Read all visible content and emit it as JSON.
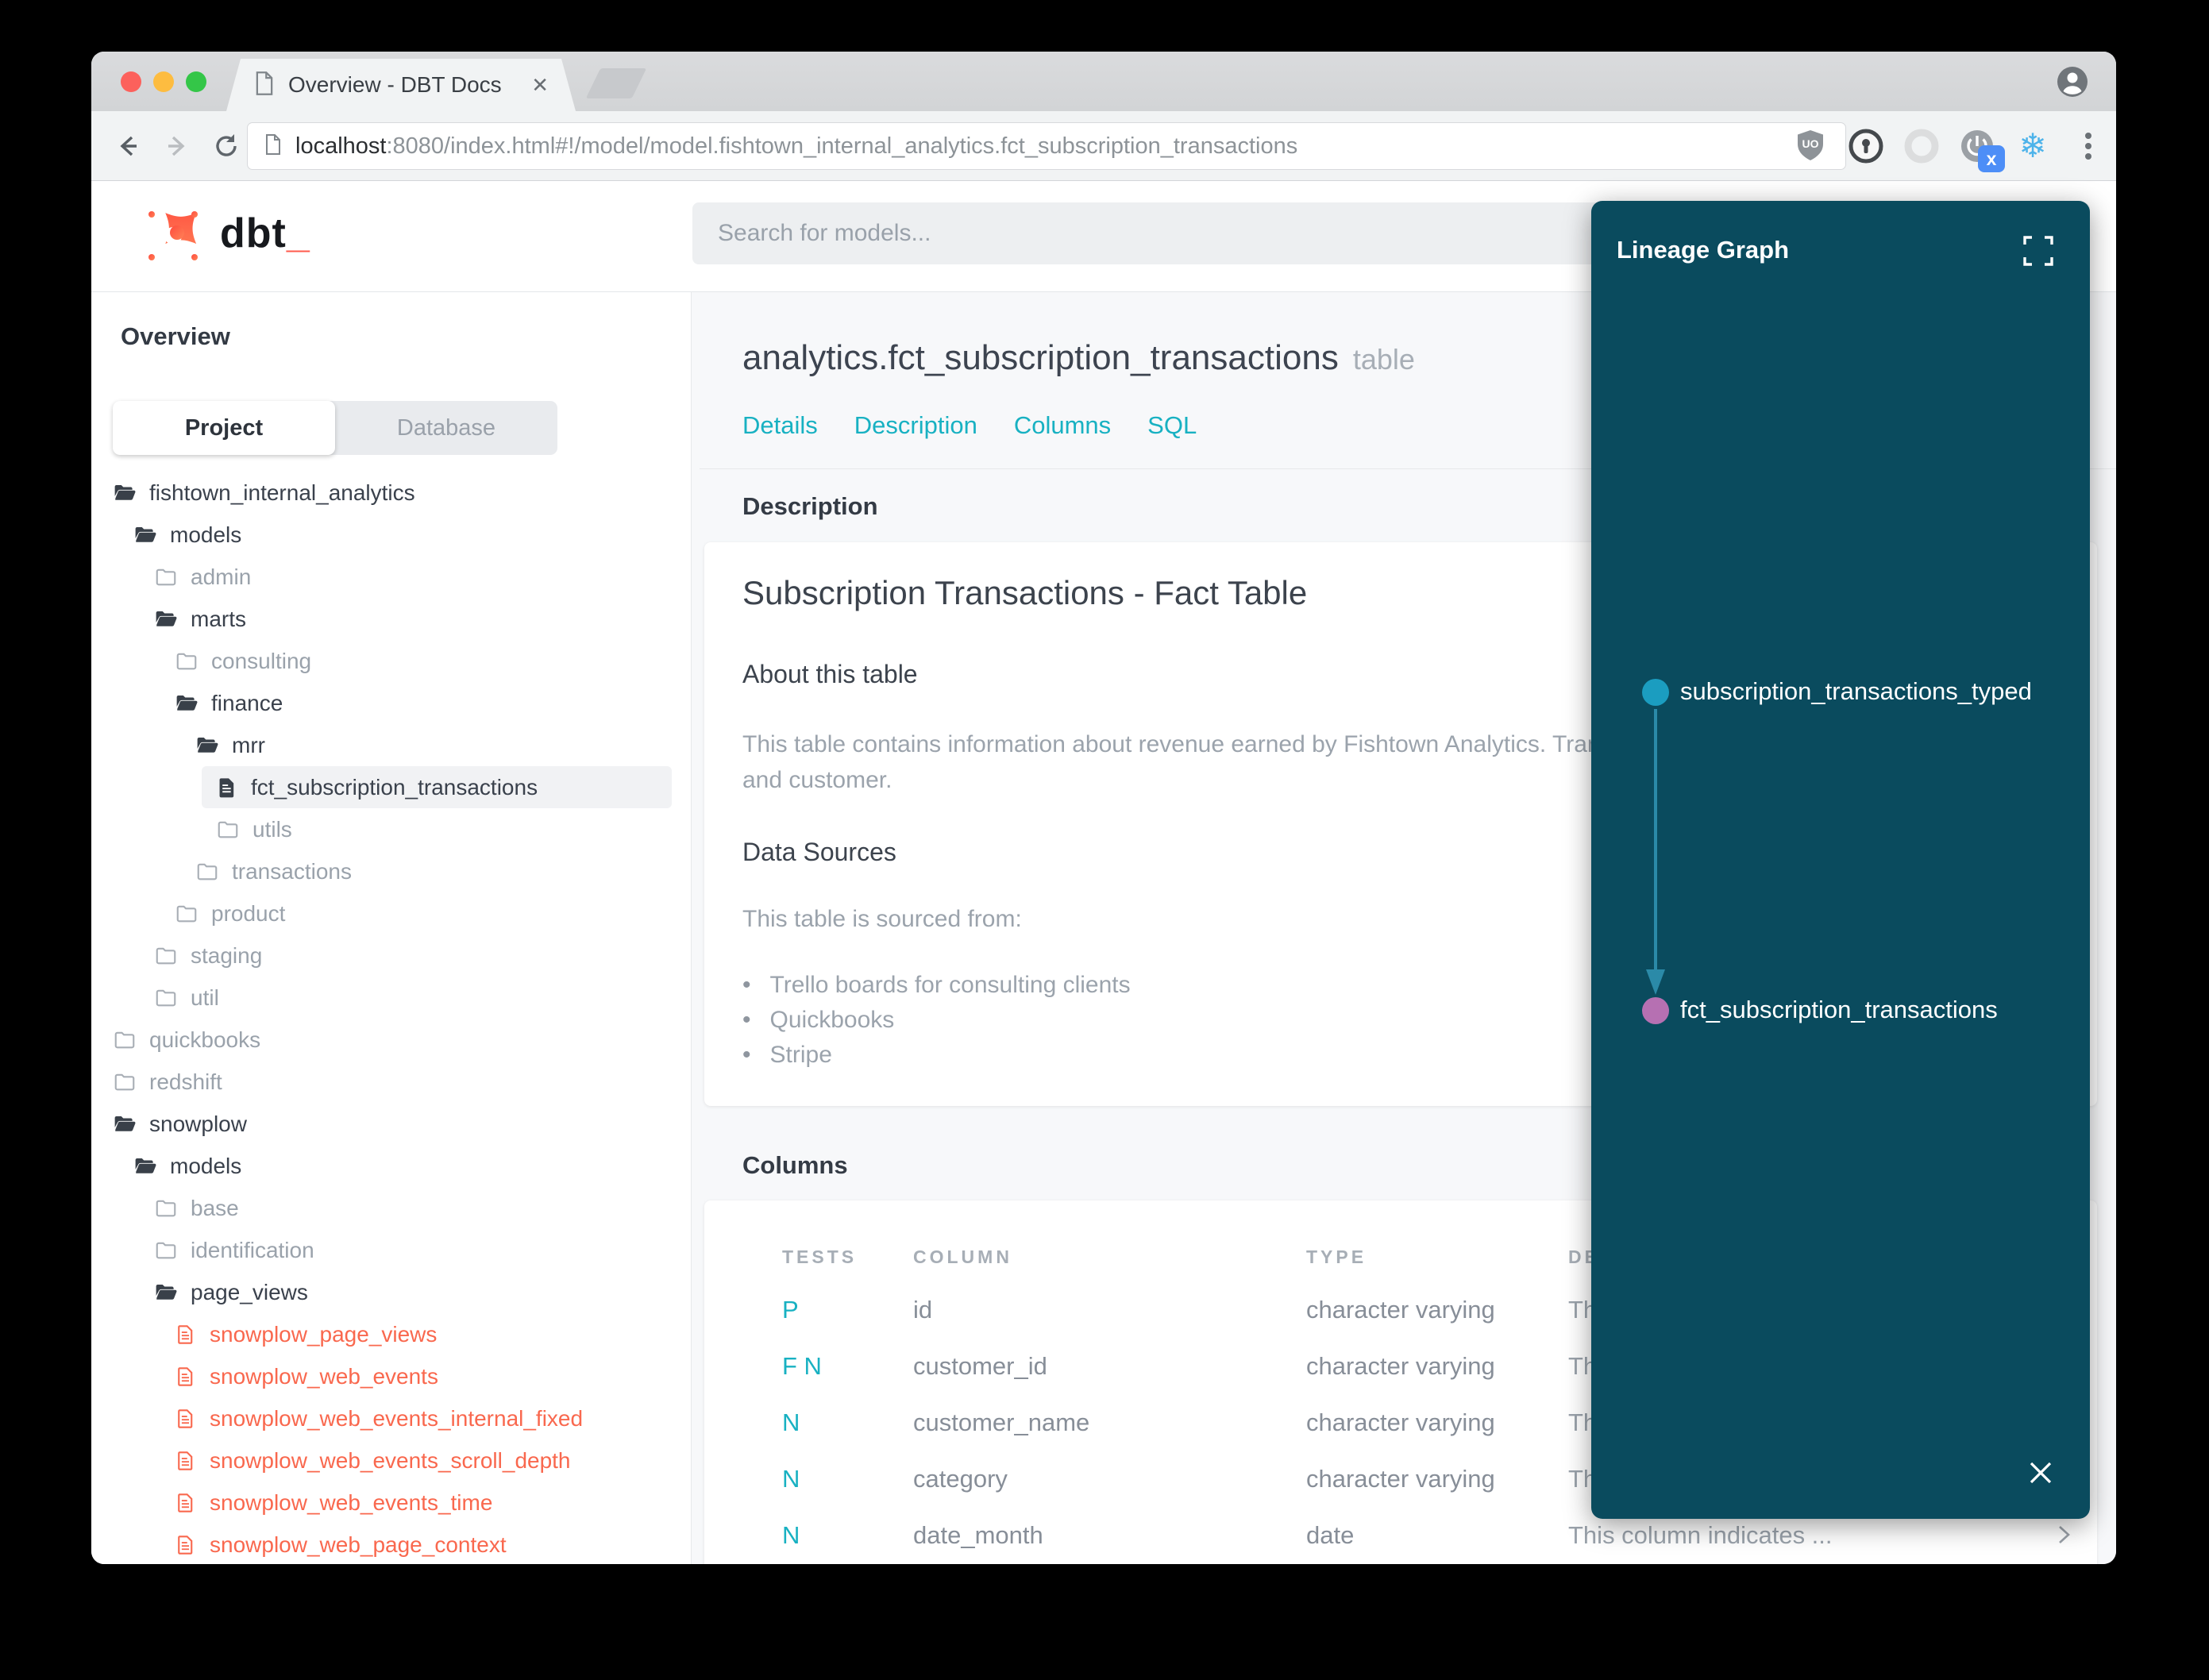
{
  "browser": {
    "tab_title": "Overview - DBT Docs",
    "tab_close": "✕",
    "url_host": "localhost",
    "url_rest": ":8080/index.html#!/model/model.fishtown_internal_analytics.fct_subscription_transactions",
    "extension_badge": "x",
    "snowflake_glyph": "❄",
    "ublock_text": "UO"
  },
  "header": {
    "logo_text": "dbt",
    "logo_underscore": "_",
    "search_placeholder": "Search for models..."
  },
  "sidebar": {
    "title": "Overview",
    "tabs": [
      {
        "label": "Project",
        "active": true
      },
      {
        "label": "Database",
        "active": false
      }
    ],
    "tree": [
      {
        "label": "fishtown_internal_analytics",
        "level": 0,
        "type": "folder-open",
        "tone": "dark"
      },
      {
        "label": "models",
        "level": 1,
        "type": "folder-open",
        "tone": "dark"
      },
      {
        "label": "admin",
        "level": 2,
        "type": "folder-closed",
        "tone": "muted"
      },
      {
        "label": "marts",
        "level": 2,
        "type": "folder-open",
        "tone": "dark"
      },
      {
        "label": "consulting",
        "level": 3,
        "type": "folder-closed",
        "tone": "muted"
      },
      {
        "label": "finance",
        "level": 3,
        "type": "folder-open",
        "tone": "dark"
      },
      {
        "label": "mrr",
        "level": 4,
        "type": "folder-open",
        "tone": "dark"
      },
      {
        "label": "fct_subscription_transactions",
        "level": 5,
        "type": "file",
        "tone": "dark",
        "selected": true
      },
      {
        "label": "utils",
        "level": 5,
        "type": "folder-closed",
        "tone": "muted"
      },
      {
        "label": "transactions",
        "level": 4,
        "type": "folder-closed",
        "tone": "muted"
      },
      {
        "label": "product",
        "level": 3,
        "type": "folder-closed",
        "tone": "muted"
      },
      {
        "label": "staging",
        "level": 2,
        "type": "folder-closed",
        "tone": "muted"
      },
      {
        "label": "util",
        "level": 2,
        "type": "folder-closed",
        "tone": "muted"
      },
      {
        "label": "quickbooks",
        "level": 0,
        "type": "folder-closed",
        "tone": "muted"
      },
      {
        "label": "redshift",
        "level": 0,
        "type": "folder-closed",
        "tone": "muted"
      },
      {
        "label": "snowplow",
        "level": 0,
        "type": "folder-open",
        "tone": "dark"
      },
      {
        "label": "models",
        "level": 1,
        "type": "folder-open",
        "tone": "dark"
      },
      {
        "label": "base",
        "level": 2,
        "type": "folder-closed",
        "tone": "muted"
      },
      {
        "label": "identification",
        "level": 2,
        "type": "folder-closed",
        "tone": "muted"
      },
      {
        "label": "page_views",
        "level": 2,
        "type": "folder-open",
        "tone": "dark"
      },
      {
        "label": "snowplow_page_views",
        "level": 3,
        "type": "file",
        "tone": "red"
      },
      {
        "label": "snowplow_web_events",
        "level": 3,
        "type": "file",
        "tone": "red"
      },
      {
        "label": "snowplow_web_events_internal_fixed",
        "level": 3,
        "type": "file",
        "tone": "red"
      },
      {
        "label": "snowplow_web_events_scroll_depth",
        "level": 3,
        "type": "file",
        "tone": "red"
      },
      {
        "label": "snowplow_web_events_time",
        "level": 3,
        "type": "file",
        "tone": "red"
      },
      {
        "label": "snowplow_web_page_context",
        "level": 3,
        "type": "file",
        "tone": "red"
      }
    ]
  },
  "main": {
    "title": "analytics.fct_subscription_transactions",
    "title_suffix": "table",
    "nav": [
      "Details",
      "Description",
      "Columns",
      "SQL"
    ],
    "description_section": {
      "heading": "Description",
      "card_title": "Subscription Transactions - Fact Table",
      "about_heading": "About this table",
      "about_text": "This table contains information about revenue earned by Fishtown Analytics. Transactions are grouped by month, category, and customer.",
      "sources_heading": "Data Sources",
      "sources_intro": "This table is sourced from:",
      "sources": [
        "Trello boards for consulting clients",
        "Quickbooks",
        "Stripe"
      ]
    },
    "columns_section": {
      "heading": "Columns",
      "table_headers": [
        "TESTS",
        "COLUMN",
        "TYPE",
        "DESCRIPTION"
      ],
      "rows": [
        {
          "tests": "P",
          "column": "id",
          "type": "character varying",
          "description": "This column indicates ..."
        },
        {
          "tests": "F N",
          "column": "customer_id",
          "type": "character varying",
          "description": "This column indicates ..."
        },
        {
          "tests": "N",
          "column": "customer_name",
          "type": "character varying",
          "description": "This column indicates ..."
        },
        {
          "tests": "N",
          "column": "category",
          "type": "character varying",
          "description": "This column indicates ..."
        },
        {
          "tests": "N",
          "column": "date_month",
          "type": "date",
          "description": "This column indicates ..."
        }
      ]
    }
  },
  "lineage": {
    "title": "Lineage Graph",
    "nodes": [
      {
        "label": "subscription_transactions_typed",
        "color": "#1b9dc0"
      },
      {
        "label": "fct_subscription_transactions",
        "color": "#b670b2"
      }
    ],
    "arrow_color": "#2b8aa8"
  },
  "colors": {
    "accent_teal": "#18b1c2",
    "model_red": "#f9684e",
    "panel_bg": "#0a4b5e",
    "badge_blue": "#4d8ef7",
    "snowflake_blue": "#4db3ea",
    "traffic_red": "#fc615c",
    "traffic_yellow": "#fdbc40",
    "traffic_green": "#34c648"
  }
}
